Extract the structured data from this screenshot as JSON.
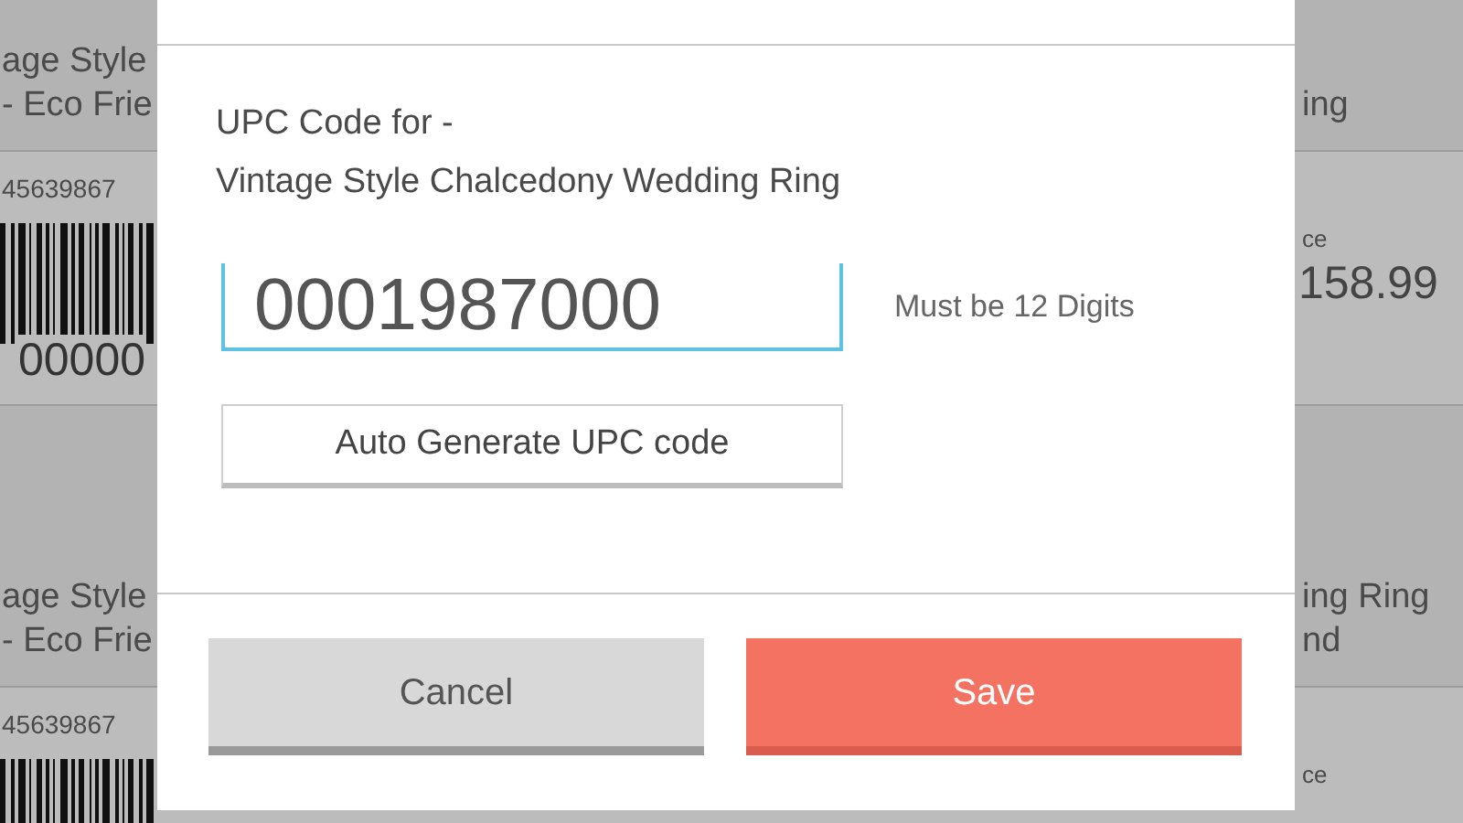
{
  "background": {
    "left_cards": [
      {
        "title_lines": [
          "age Style",
          "- Eco Frie"
        ],
        "code": "45639867",
        "barcode_number": "00000"
      },
      {
        "title_lines": [
          "age Style",
          "- Eco Frie"
        ],
        "code": "45639867"
      }
    ],
    "right_cards": [
      {
        "title_lines": [
          "ing"
        ],
        "price_label": "ce",
        "price": "158.99"
      },
      {
        "title_lines": [
          "ing Ring",
          "nd"
        ],
        "price_label": "ce"
      }
    ]
  },
  "dialog": {
    "heading": "UPC Code for -",
    "product": "Vintage Style Chalcedony Wedding Ring",
    "upc_field": {
      "value": "0001987000"
    },
    "hint": "Must be 12 Digits",
    "auto_button": "Auto Generate UPC code",
    "buttons": [
      {
        "label": "Cancel",
        "kind": "cancel"
      },
      {
        "label": "Save",
        "kind": "primary"
      }
    ]
  }
}
